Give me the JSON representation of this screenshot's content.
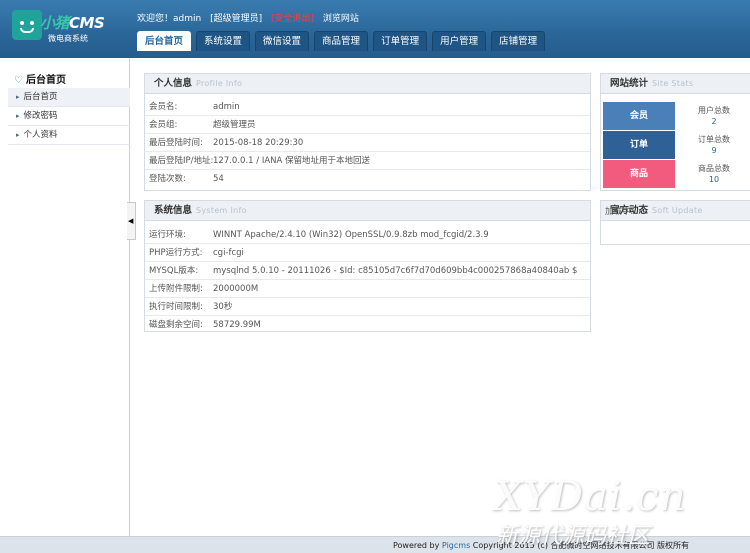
{
  "logo": {
    "title_part1": "小猪",
    "title_part2": "CMS",
    "subtitle": "微电商系统"
  },
  "toplinks": {
    "welcome": "欢迎您！admin",
    "role": "[超级管理员]",
    "logout": "[安全退出]",
    "browse": "浏览网站"
  },
  "nav": {
    "tabs": [
      {
        "label": "后台首页",
        "active": true
      },
      {
        "label": "系统设置"
      },
      {
        "label": "微信设置"
      },
      {
        "label": "商品管理"
      },
      {
        "label": "订单管理"
      },
      {
        "label": "用户管理"
      },
      {
        "label": "店铺管理"
      }
    ]
  },
  "sidebar": {
    "title": "后台首页",
    "items": [
      {
        "label": "后台首页"
      },
      {
        "label": "修改密码"
      },
      {
        "label": "个人资料"
      }
    ]
  },
  "personal": {
    "title": "个人信息",
    "title_en": "Profile Info",
    "rows": [
      {
        "label": "会员名:",
        "value": "admin"
      },
      {
        "label": "会员组:",
        "value": "超级管理员"
      },
      {
        "label": "最后登陆时间:",
        "value": "2015-08-18 20:29:30"
      },
      {
        "label": "最后登陆IP/地址:",
        "value": "127.0.0.1 / IANA 保留地址用于本地回送"
      },
      {
        "label": "登陆次数:",
        "value": "54"
      }
    ]
  },
  "system": {
    "title": "系统信息",
    "title_en": "System Info",
    "rows": [
      {
        "label": "运行环境:",
        "value": "WINNT Apache/2.4.10 (Win32) OpenSSL/0.9.8zb mod_fcgid/2.3.9"
      },
      {
        "label": "PHP运行方式:",
        "value": "cgi-fcgi"
      },
      {
        "label": "MYSQL版本:",
        "value": "mysqlnd 5.0.10 - 20111026 - $Id: c85105d7c6f7d70d609bb4c000257868a40840ab $"
      },
      {
        "label": "上传附件限制:",
        "value": "2000000M"
      },
      {
        "label": "执行时间限制:",
        "value": "30秒"
      },
      {
        "label": "磁盘剩余空间:",
        "value": "58729.99M"
      }
    ]
  },
  "stats": {
    "title": "网站统计",
    "title_en": "Site Stats",
    "items": [
      {
        "label": "会员",
        "info_label": "用户总数",
        "count": "2",
        "color": "#4a7fb8"
      },
      {
        "label": "订单",
        "info_label": "订单总数",
        "count": "9",
        "color": "#2f6196"
      },
      {
        "label": "商品",
        "info_label": "商品总数",
        "count": "10",
        "color": "#f25a7e"
      }
    ]
  },
  "updates": {
    "title": "官方动态",
    "title_en": "Soft Update",
    "loading": "加载中..."
  },
  "footer": {
    "prefix": "Powered by ",
    "brand": "Pigcms",
    "suffix": " Copyright 2015 (c) 合肥微时空网络技术有限公司 版权所有"
  },
  "watermark": {
    "big": "XYDai.cn",
    "small": "新源代源码社区"
  }
}
